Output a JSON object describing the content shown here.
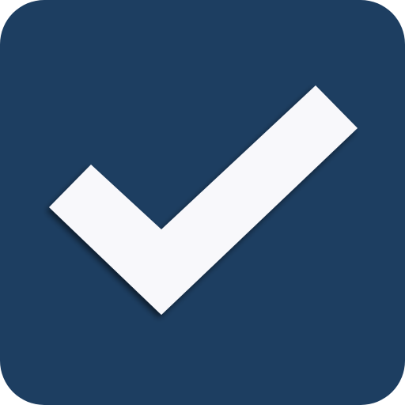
{
  "checkbox": {
    "state": "checked",
    "icon": "checkmark-icon",
    "colors": {
      "background": "#1d3e61",
      "check": "#f8f8fb",
      "check_shadow": "#0b1f33"
    }
  }
}
